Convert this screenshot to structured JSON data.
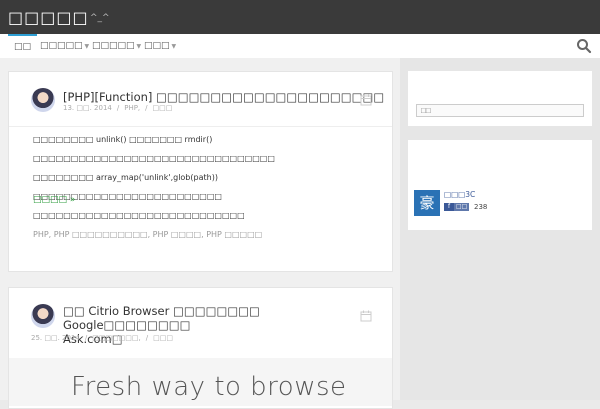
{
  "header": {
    "site_title": "□□□□□",
    "tagline": "^_^"
  },
  "nav": {
    "items": [
      {
        "label": "□□",
        "active": true
      },
      {
        "label": "□□□□□",
        "has_dropdown": true
      },
      {
        "label": "□□□□□",
        "has_dropdown": true
      },
      {
        "label": "□□□",
        "has_dropdown": true
      }
    ],
    "search_icon": "search-icon"
  },
  "posts": [
    {
      "title": "[PHP][Function] □□□□□□□□□□□□□□□□□□□□□",
      "date": "13. □□. 2014",
      "category": "PHP,",
      "comments": "□□□",
      "excerpt_lines": [
        "□□□□□□□□ unlink() □□□□□□□ rmdir() □□□□□□□□□□□□□□□□□□□□□□□□□□□□□□□□",
        "□□□□□□□□ array_map('unlink',glob(path)) □□□□□□□□□□□□□□□□□□□□□□□□□",
        "□□□□□□□□□□□□□□□□□□□□□□□□□□□□"
      ],
      "more_label": "□□□□ »",
      "tags": [
        "PHP",
        "PHP □□□□□□□□□□",
        "PHP □□□□",
        "PHP □□□□□"
      ]
    },
    {
      "title_line1": "□□ Citrio Browser □□□□□□□□ Google□□□□□□□□",
      "title_line2": "Ask.com□",
      "date": "25. □□. 2014",
      "category": "□□□□□□□,",
      "comments": "□□□",
      "featured_caption": "Fresh way to browse"
    }
  ],
  "sidebar": {
    "search_placeholder": "□□",
    "fb_widget": {
      "logo_char": "豪",
      "page_name": "□□□3C",
      "like_label": "□□",
      "like_count": "238"
    }
  },
  "colors": {
    "header_bg": "#3a3a3a",
    "nav_active": "#2e9fd4",
    "more_link": "#2f9e3f",
    "fb_blue": "#3b5998"
  }
}
